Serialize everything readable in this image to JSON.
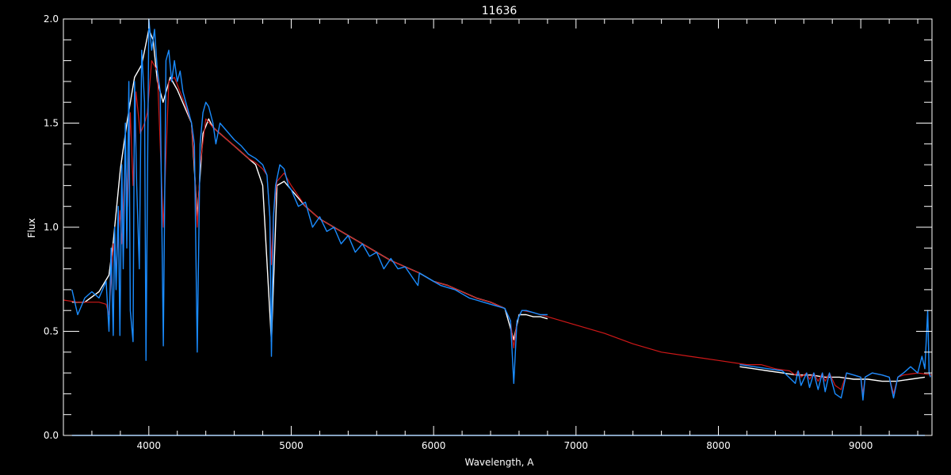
{
  "chart_data": {
    "type": "line",
    "title": "11636",
    "xlabel": "Wavelength, A",
    "ylabel": "Flux",
    "xlim": [
      3400,
      9500
    ],
    "ylim": [
      0.0,
      2.0
    ],
    "x_ticks": [
      4000,
      5000,
      6000,
      7000,
      8000,
      9000
    ],
    "x_tick_labels": [
      "4000",
      "5000",
      "6000",
      "7000",
      "8000",
      "9000"
    ],
    "y_ticks": [
      0.0,
      0.5,
      1.0,
      1.5,
      2.0
    ],
    "y_tick_labels": [
      "0.0",
      "0.5",
      "1.0",
      "1.5",
      "2.0"
    ],
    "grid": false,
    "legend": "none",
    "background_color": "#000000",
    "axis_color": "#ffffff",
    "series": [
      {
        "color": "#ffffff",
        "segments": [
          {
            "x": [
              3460,
              3550,
              3650,
              3720,
              3750,
              3800,
              3850,
              3900,
              3950,
              4000,
              4030,
              4060,
              4100,
              4150,
              4200,
              4250,
              4300,
              4340,
              4380,
              4420,
              4450,
              4500,
              4550,
              4600,
              4650,
              4700,
              4750,
              4800,
              4861,
              4900,
              4950,
              5000,
              5100,
              5200,
              5300,
              5400,
              5500,
              5600,
              5700,
              5800,
              5900,
              6000,
              6100,
              6200,
              6300,
              6400,
              6500,
              6563,
              6600,
              6650,
              6700,
              6750,
              6800
            ],
            "y": [
              0.64,
              0.64,
              0.69,
              0.77,
              0.93,
              1.28,
              1.52,
              1.72,
              1.78,
              1.95,
              1.9,
              1.7,
              1.6,
              1.72,
              1.66,
              1.58,
              1.5,
              1.05,
              1.45,
              1.52,
              1.48,
              1.45,
              1.42,
              1.39,
              1.36,
              1.33,
              1.3,
              1.2,
              0.45,
              1.2,
              1.22,
              1.18,
              1.1,
              1.04,
              1.0,
              0.96,
              0.92,
              0.88,
              0.84,
              0.81,
              0.78,
              0.74,
              0.72,
              0.69,
              0.66,
              0.64,
              0.61,
              0.46,
              0.58,
              0.58,
              0.57,
              0.57,
              0.56
            ]
          },
          {
            "x": [
              8150,
              8250,
              8350,
              8450,
              8550,
              8650,
              8750,
              8850,
              8950,
              9050,
              9150,
              9250,
              9350,
              9450
            ],
            "y": [
              0.33,
              0.32,
              0.31,
              0.3,
              0.29,
              0.29,
              0.28,
              0.28,
              0.27,
              0.27,
              0.26,
              0.26,
              0.27,
              0.28
            ]
          }
        ]
      },
      {
        "color": "#d01818",
        "segments": [
          {
            "x": [
              3400,
              3500,
              3600,
              3650,
              3700,
              3720,
              3750,
              3770,
              3797,
              3810,
              3835,
              3850,
              3870,
              3889,
              3910,
              3940,
              3970,
              3990,
              4020,
              4060,
              4102,
              4140,
              4180,
              4220,
              4260,
              4300,
              4320,
              4340,
              4360,
              4400,
              4450,
              4500,
              4550,
              4600,
              4650,
              4700,
              4750,
              4800,
              4830,
              4850,
              4861,
              4875,
              4900,
              4950,
              5000,
              5100,
              5200,
              5300,
              5400,
              5500,
              5600,
              5700,
              5800,
              5900,
              6000,
              6100,
              6200,
              6300,
              6400,
              6500,
              6540,
              6563,
              6585,
              6620,
              6700,
              6800,
              7000,
              7200,
              7400,
              7600,
              7800,
              8000,
              8200,
              8300,
              8400,
              8500,
              8540,
              8560,
              8580,
              8620,
              8640,
              8670,
              8700,
              8730,
              8750,
              8780,
              8820,
              8862,
              8900,
              8950,
              9000,
              9015,
              9030,
              9080,
              9150,
              9200,
              9230,
              9260,
              9300,
              9400,
              9500
            ],
            "y": [
              0.65,
              0.64,
              0.64,
              0.64,
              0.63,
              0.58,
              0.92,
              0.8,
              1.08,
              0.92,
              1.35,
              1.1,
              1.55,
              1.2,
              1.65,
              1.45,
              1.5,
              1.55,
              1.8,
              1.75,
              1.0,
              1.7,
              1.72,
              1.65,
              1.58,
              1.5,
              1.3,
              1.0,
              1.3,
              1.52,
              1.48,
              1.45,
              1.42,
              1.39,
              1.36,
              1.33,
              1.31,
              1.28,
              1.25,
              1.05,
              0.82,
              1.05,
              1.22,
              1.26,
              1.2,
              1.1,
              1.04,
              1.0,
              0.96,
              0.92,
              0.88,
              0.84,
              0.81,
              0.78,
              0.74,
              0.72,
              0.69,
              0.66,
              0.64,
              0.61,
              0.55,
              0.42,
              0.55,
              0.6,
              0.59,
              0.57,
              0.53,
              0.49,
              0.44,
              0.4,
              0.38,
              0.36,
              0.34,
              0.34,
              0.32,
              0.31,
              0.29,
              0.31,
              0.28,
              0.3,
              0.27,
              0.3,
              0.26,
              0.3,
              0.26,
              0.3,
              0.24,
              0.22,
              0.3,
              0.29,
              0.28,
              0.2,
              0.28,
              0.3,
              0.29,
              0.28,
              0.2,
              0.28,
              0.29,
              0.3,
              0.29
            ]
          }
        ]
      },
      {
        "color": "#1a8cff",
        "segments": [
          {
            "x": [
              3460,
              3500,
              3550,
              3600,
              3650,
              3700,
              3720,
              3735,
              3750,
              3760,
              3770,
              3785,
              3797,
              3810,
              3820,
              3835,
              3845,
              3860,
              3870,
              3889,
              3900,
              3915,
              3933,
              3950,
              3970,
              3980,
              4000,
              4020,
              4040,
              4060,
              4080,
              4102,
              4120,
              4140,
              4160,
              4180,
              4200,
              4220,
              4240,
              4260,
              4280,
              4300,
              4320,
              4340,
              4360,
              4380,
              4400,
              4420,
              4450,
              4471,
              4500,
              4550,
              4600,
              4650,
              4700,
              4750,
              4800,
              4830,
              4850,
              4861,
              4875,
              4890,
              4920,
              4950,
              4980,
              5000,
              5050,
              5100,
              5150,
              5200,
              5250,
              5300,
              5350,
              5400,
              5450,
              5500,
              5550,
              5600,
              5650,
              5700,
              5750,
              5800,
              5850,
              5890,
              5900,
              5950,
              6000,
              6050,
              6100,
              6150,
              6200,
              6250,
              6300,
              6350,
              6400,
              6450,
              6500,
              6540,
              6563,
              6585,
              6620,
              6650,
              6700,
              6750,
              6800
            ],
            "y": [
              0.7,
              0.58,
              0.66,
              0.69,
              0.66,
              0.74,
              0.5,
              0.9,
              0.48,
              1.0,
              0.7,
              1.1,
              0.48,
              1.3,
              0.8,
              1.5,
              0.9,
              1.7,
              0.6,
              0.45,
              1.7,
              1.2,
              0.8,
              1.85,
              1.6,
              0.36,
              2.0,
              1.85,
              1.95,
              1.75,
              1.65,
              0.43,
              1.8,
              1.85,
              1.7,
              1.8,
              1.7,
              1.75,
              1.65,
              1.6,
              1.55,
              1.5,
              1.4,
              0.4,
              1.4,
              1.55,
              1.6,
              1.58,
              1.5,
              1.4,
              1.5,
              1.46,
              1.42,
              1.39,
              1.35,
              1.33,
              1.3,
              1.25,
              1.05,
              0.38,
              1.05,
              1.2,
              1.3,
              1.28,
              1.2,
              1.18,
              1.1,
              1.12,
              1.0,
              1.05,
              0.98,
              1.0,
              0.92,
              0.96,
              0.88,
              0.92,
              0.86,
              0.88,
              0.8,
              0.85,
              0.8,
              0.81,
              0.76,
              0.72,
              0.78,
              0.76,
              0.74,
              0.72,
              0.71,
              0.7,
              0.68,
              0.66,
              0.65,
              0.64,
              0.63,
              0.62,
              0.61,
              0.55,
              0.25,
              0.55,
              0.6,
              0.6,
              0.59,
              0.58,
              0.58
            ]
          },
          {
            "x": [
              8150,
              8250,
              8350,
              8450,
              8540,
              8560,
              8580,
              8620,
              8640,
              8670,
              8700,
              8730,
              8750,
              8780,
              8820,
              8862,
              8900,
              8950,
              9000,
              9015,
              9030,
              9080,
              9150,
              9200,
              9230,
              9260,
              9300,
              9350,
              9400,
              9430,
              9450,
              9470,
              9480,
              9490
            ],
            "y": [
              0.34,
              0.33,
              0.32,
              0.31,
              0.25,
              0.31,
              0.24,
              0.3,
              0.23,
              0.3,
              0.22,
              0.3,
              0.21,
              0.3,
              0.2,
              0.18,
              0.3,
              0.29,
              0.28,
              0.17,
              0.28,
              0.3,
              0.29,
              0.28,
              0.18,
              0.28,
              0.3,
              0.33,
              0.3,
              0.38,
              0.32,
              0.6,
              0.3,
              0.28
            ]
          },
          {
            "x": [
              3460,
              5500,
              6500,
              7500,
              8500,
              9200,
              9450
            ],
            "y": [
              0.0,
              0.0,
              0.0,
              0.0,
              0.0,
              0.0,
              0.0
            ]
          }
        ]
      }
    ]
  }
}
